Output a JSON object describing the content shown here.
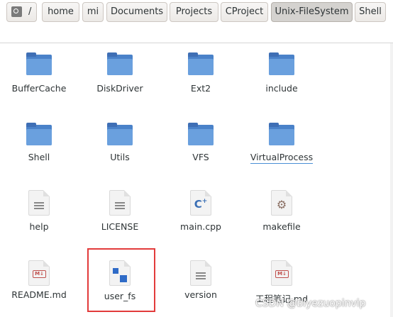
{
  "pathbar": {
    "root": "/",
    "crumbs": [
      "home",
      "mi",
      "Documents",
      "Projects",
      "CProject",
      "Unix-FileSystem",
      "Shell"
    ],
    "active": "Unix-FileSystem"
  },
  "files": [
    {
      "name": "BufferCache",
      "kind": "folder"
    },
    {
      "name": "DiskDriver",
      "kind": "folder"
    },
    {
      "name": "Ext2",
      "kind": "folder"
    },
    {
      "name": "include",
      "kind": "folder"
    },
    {
      "name": "Shell",
      "kind": "folder"
    },
    {
      "name": "Utils",
      "kind": "folder"
    },
    {
      "name": "VFS",
      "kind": "folder"
    },
    {
      "name": "VirtualProcess",
      "kind": "folder"
    },
    {
      "name": "help",
      "kind": "text"
    },
    {
      "name": "LICENSE",
      "kind": "text"
    },
    {
      "name": "main.cpp",
      "kind": "cpp"
    },
    {
      "name": "makefile",
      "kind": "makefile"
    },
    {
      "name": "README.md",
      "kind": "markdown"
    },
    {
      "name": "user_fs",
      "kind": "executable"
    },
    {
      "name": "version",
      "kind": "text"
    },
    {
      "name": "工程笔记.md",
      "kind": "markdown"
    }
  ],
  "icons": {
    "folder": "folder-icon",
    "text": "text-file-icon",
    "cpp": "cpp-file-icon",
    "makefile": "makefile-gear-icon",
    "markdown": "markdown-file-icon",
    "executable": "executable-file-icon"
  },
  "watermark": "CSDN @biyezuopinvip",
  "colors": {
    "folder": "#4a82c9",
    "highlight": "#e23b3b"
  }
}
